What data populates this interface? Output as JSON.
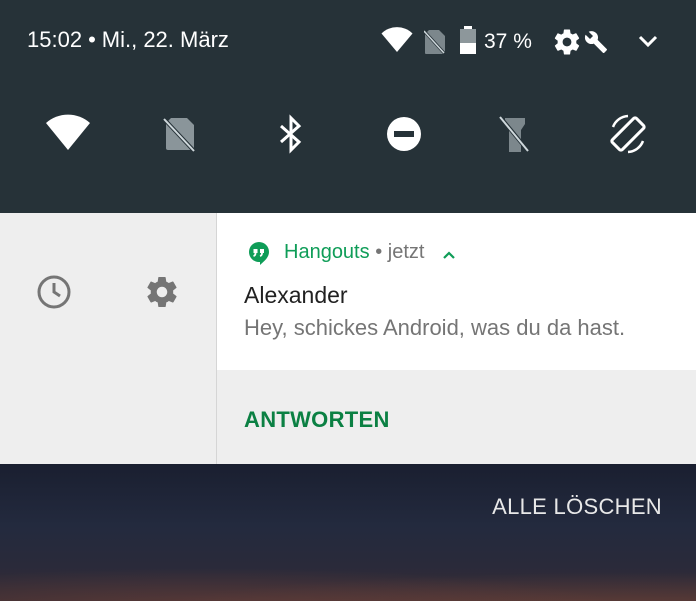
{
  "status_bar": {
    "time": "15:02",
    "separator": "•",
    "date": "Mi., 22. März",
    "battery_percent": "37 %"
  },
  "quick_settings": {
    "tiles": [
      "wifi-icon",
      "no-sim-icon",
      "bluetooth-icon",
      "do-not-disturb-icon",
      "flashlight-icon",
      "auto-rotate-icon"
    ]
  },
  "notification": {
    "app_name": "Hangouts",
    "meta_separator": "•",
    "time": "jetzt",
    "title": "Alexander",
    "text": "Hey, schickes Android, was du da hast.",
    "action_label": "ANTWORTEN",
    "accent_color": "#0f9d58"
  },
  "clear_all_label": "ALLE LÖSCHEN"
}
